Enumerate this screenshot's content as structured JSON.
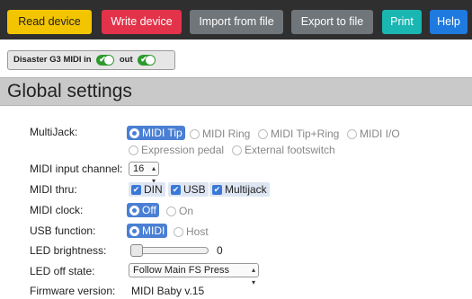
{
  "toolbar": {
    "buttons": [
      {
        "label": "Read device",
        "color": "#f3c500",
        "text_color": "#222222"
      },
      {
        "label": "Write device",
        "color": "#e2334a",
        "text_color": "#ffffff"
      },
      {
        "label": "Import from file",
        "color": "#707579",
        "text_color": "#ffffff"
      },
      {
        "label": "Export to file",
        "color": "#707579",
        "text_color": "#ffffff"
      },
      {
        "label": "Print",
        "color": "#1ab6b2",
        "text_color": "#ffffff"
      },
      {
        "label": "Help",
        "color": "#1f7ae0",
        "text_color": "#ffffff"
      }
    ]
  },
  "status": {
    "device_name": "Disaster G3 MIDI",
    "in_label": "in",
    "out_label": "out",
    "in_on": true,
    "out_on": true
  },
  "section": {
    "title": "Global settings"
  },
  "settings": {
    "multijack": {
      "label": "MultiJack:",
      "options": [
        "MIDI Tip",
        "MIDI Ring",
        "MIDI Tip+Ring",
        "MIDI I/O",
        "Expression pedal",
        "External footswitch"
      ],
      "selected": "MIDI Tip"
    },
    "midi_input_channel": {
      "label": "MIDI input channel:",
      "value": "16"
    },
    "midi_thru": {
      "label": "MIDI thru:",
      "options": [
        "DIN",
        "USB",
        "Multijack"
      ],
      "checked": [
        "DIN",
        "USB",
        "Multijack"
      ]
    },
    "midi_clock": {
      "label": "MIDI clock:",
      "options": [
        "Off",
        "On"
      ],
      "selected": "Off"
    },
    "usb_function": {
      "label": "USB function:",
      "options": [
        "MIDI",
        "Host"
      ],
      "selected": "MIDI"
    },
    "led_brightness": {
      "label": "LED brightness:",
      "value": "0",
      "level": 0
    },
    "led_off_state": {
      "label": "LED off state:",
      "value": "Follow Main FS Press"
    },
    "firmware_version": {
      "label": "Firmware version:",
      "value": "MIDI Baby v.15"
    }
  },
  "icons": {
    "dropdown": "updown-arrow-icon",
    "toggle": "toggle-switch-icon",
    "check": "checkmark-icon",
    "radio": "radio-icon"
  },
  "colors": {
    "selected_radio": "#4a7fd4",
    "checkbox": "#3a78d6",
    "toggle_on": "#2e9a2e"
  }
}
